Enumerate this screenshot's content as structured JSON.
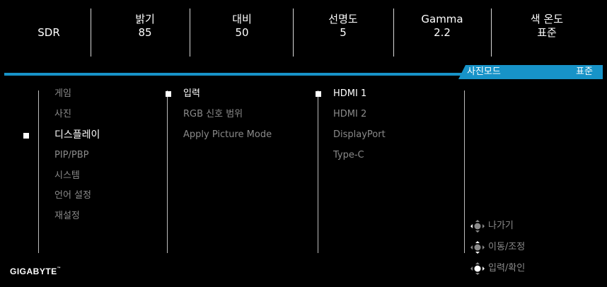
{
  "status": {
    "sdr": "SDR",
    "brightness_label": "밝기",
    "brightness_value": "85",
    "contrast_label": "대비",
    "contrast_value": "50",
    "sharpness_label": "선명도",
    "sharpness_value": "5",
    "gamma_label": "Gamma",
    "gamma_value": "2.2",
    "color_temp_label": "색 온도",
    "color_temp_value": "표준"
  },
  "mode_bar": {
    "label": "사진모드",
    "value": "표준",
    "color": "#1793c8"
  },
  "main_menu": [
    "게임",
    "사진",
    "디스플레이",
    "PIP/PBP",
    "시스템",
    "언어 설정",
    "재설정"
  ],
  "sub_menu": [
    "입력",
    "RGB 신호 범위",
    "Apply Picture Mode"
  ],
  "input_menu": [
    "HDMI 1",
    "HDMI 2",
    "DisplayPort",
    "Type-C"
  ],
  "hints": {
    "exit": "나가기",
    "move_adjust": "이동/조정",
    "enter_confirm": "입력/확인"
  },
  "brand": "GIGABYTE",
  "trademark": "™"
}
